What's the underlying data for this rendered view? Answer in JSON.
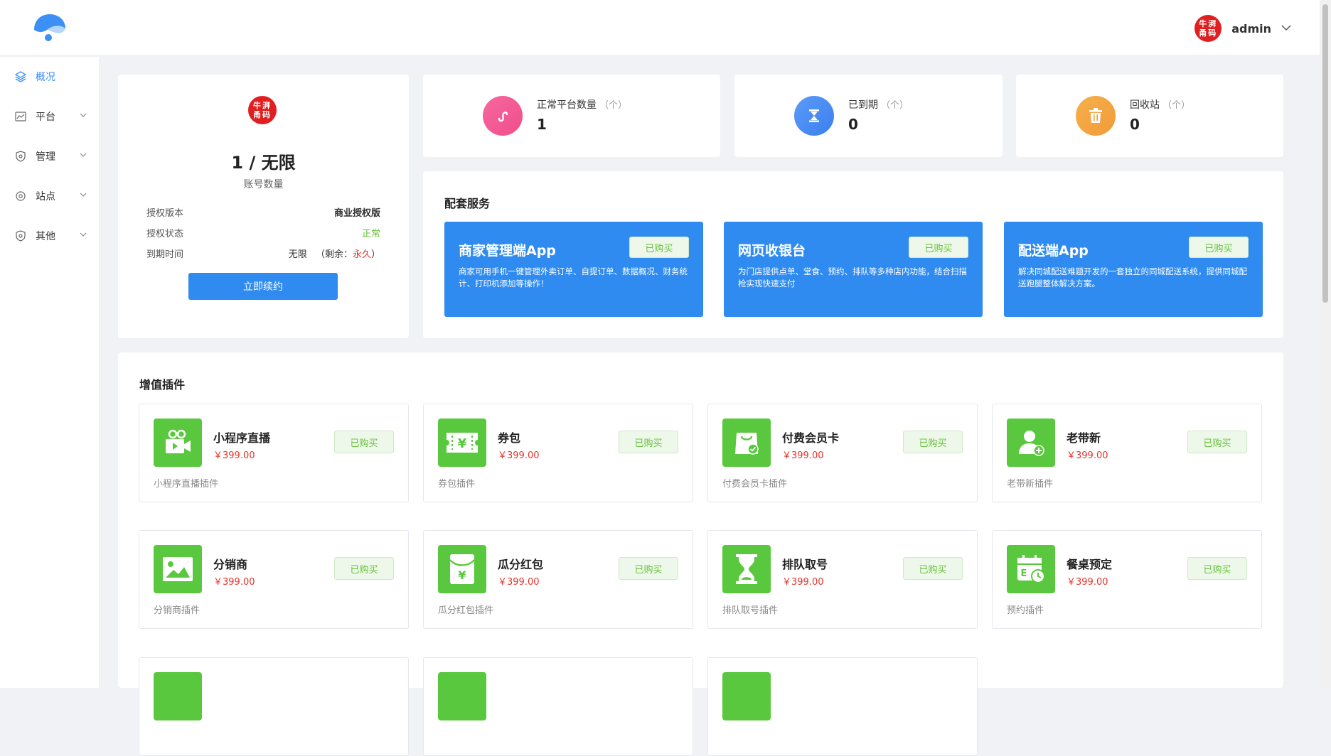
{
  "header": {
    "username": "admin",
    "avatar_text": "牛湃甬码"
  },
  "sidebar": {
    "items": [
      {
        "label": "概况"
      },
      {
        "label": "平台"
      },
      {
        "label": "管理"
      },
      {
        "label": "站点"
      },
      {
        "label": "其他"
      }
    ]
  },
  "license": {
    "badge_text": "牛湃甬码",
    "count": "1 / 无限",
    "count_label": "账号数量",
    "version_label": "授权版本",
    "version_value": "商业授权版",
    "status_label": "授权状态",
    "status_value": "正常",
    "expire_label": "到期时间",
    "expire_value": "无限",
    "remain_prefix": "（剩余：",
    "remain_value": "永久",
    "remain_suffix": "）",
    "renew_button": "立即续约"
  },
  "stats": [
    {
      "label": "正常平台数量",
      "unit": "（个）",
      "value": "1",
      "icon": "mini-program-icon",
      "color": "#f04e8a"
    },
    {
      "label": "已到期",
      "unit": "（个）",
      "value": "0",
      "icon": "hourglass-icon",
      "color": "#3b7ff0"
    },
    {
      "label": "回收站",
      "unit": "（个）",
      "value": "0",
      "icon": "trash-icon",
      "color": "#f29a38"
    }
  ],
  "services": {
    "title": "配套服务",
    "items": [
      {
        "title": "商家管理端App",
        "desc": "商家可用手机一键管理外卖订单、自提订单、数据概况、财务统计、打印机添加等操作！",
        "button": "已购买"
      },
      {
        "title": "网页收银台",
        "desc": "为门店提供点单、堂食、预约、排队等多种店内功能，结合扫描枪实现快速支付",
        "button": "已购买"
      },
      {
        "title": "配送端App",
        "desc": "解决同城配送难题开发的一套独立的同城配送系统，提供同城配送跑腿整体解决方案。",
        "button": "已购买"
      }
    ]
  },
  "plugins": {
    "title": "增值插件",
    "items": [
      {
        "name": "小程序直播",
        "price": "￥399.00",
        "desc": "小程序直播插件",
        "button": "已购买",
        "icon": "live-video-icon"
      },
      {
        "name": "券包",
        "price": "￥399.00",
        "desc": "券包插件",
        "button": "已购买",
        "icon": "coupon-icon"
      },
      {
        "name": "付费会员卡",
        "price": "￥399.00",
        "desc": "付费会员卡插件",
        "button": "已购买",
        "icon": "member-card-icon"
      },
      {
        "name": "老带新",
        "price": "￥399.00",
        "desc": "老带新插件",
        "button": "已购买",
        "icon": "add-user-icon"
      },
      {
        "name": "分销商",
        "price": "￥399.00",
        "desc": "分销商插件",
        "button": "已购买",
        "icon": "image-icon"
      },
      {
        "name": "瓜分红包",
        "price": "￥399.00",
        "desc": "瓜分红包插件",
        "button": "已购买",
        "icon": "red-packet-icon"
      },
      {
        "name": "排队取号",
        "price": "￥399.00",
        "desc": "排队取号插件",
        "button": "已购买",
        "icon": "hourglass-icon"
      },
      {
        "name": "餐桌预定",
        "price": "￥399.00",
        "desc": "预约插件",
        "button": "已购买",
        "icon": "calendar-clock-icon"
      }
    ]
  }
}
